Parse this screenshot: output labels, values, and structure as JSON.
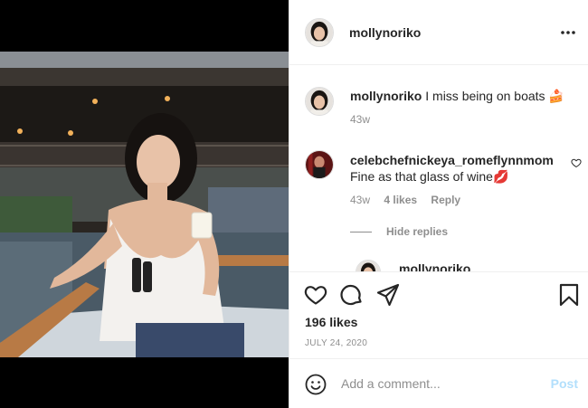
{
  "post": {
    "username": "mollynoriko",
    "more_icon": "more-horizontal-icon"
  },
  "caption": {
    "username": "mollynoriko",
    "text": "I miss being on boats 🍰",
    "time": "43w"
  },
  "comments": [
    {
      "username": "celebchefnickeya_romeflynnmom",
      "text": "Fine as that glass of wine💋",
      "time": "43w",
      "likes": "4 likes",
      "reply_label": "Reply"
    }
  ],
  "replies_toggle": "Hide replies",
  "reply_preview": {
    "username": "mollynoriko"
  },
  "actions": {
    "icons": [
      "heart-icon",
      "comment-icon",
      "share-icon",
      "bookmark-icon"
    ]
  },
  "likes": "196 likes",
  "date": "JULY 24, 2020",
  "comment_box": {
    "placeholder": "Add a comment...",
    "post_label": "Post"
  },
  "colors": {
    "text": "#262626",
    "secondary": "#8e8e8e",
    "post_disabled": "#b2dffc",
    "divider": "#efefef"
  }
}
